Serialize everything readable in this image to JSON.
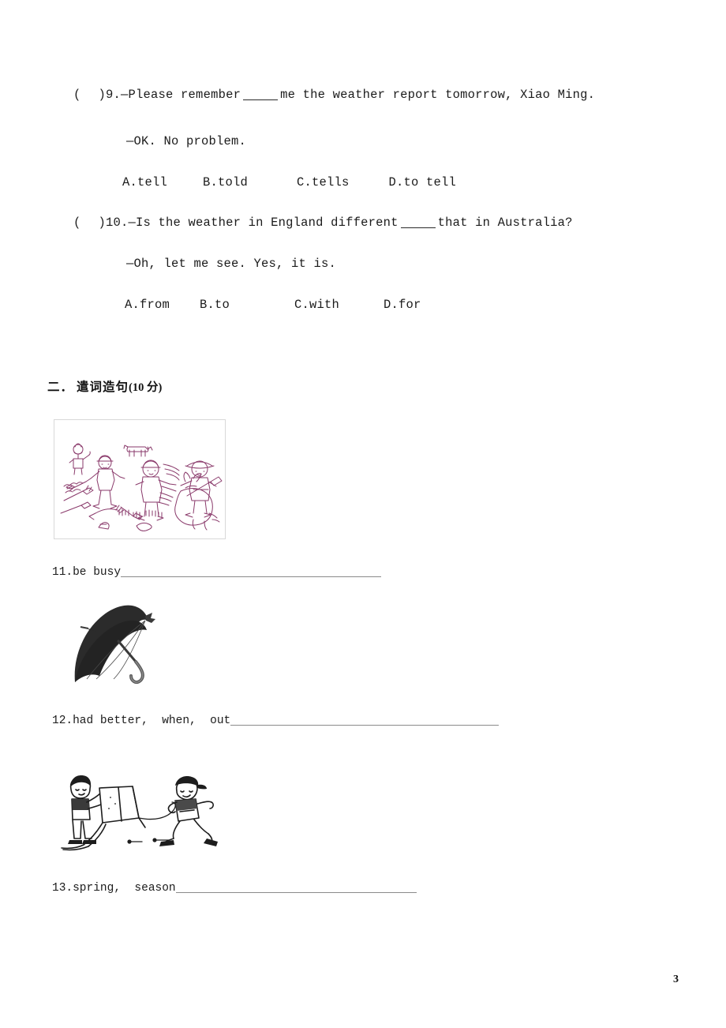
{
  "document": {
    "page_number": "3",
    "questions": [
      {
        "id": "q9",
        "marker_open": "(",
        "marker_close": ")",
        "number": "9.",
        "stem_before": "—Please remember",
        "stem_after": "me the weather report tomorrow, Xiao Ming.",
        "reply": "—OK. No problem.",
        "options": [
          "A.tell",
          "B.told",
          "C.tells",
          "D.to tell"
        ]
      },
      {
        "id": "q10",
        "marker_open": "(",
        "marker_close": ")",
        "number": "10.",
        "stem_before": "—Is the weather in England different",
        "stem_after": "that in Australia?",
        "reply": "—Oh, let me see. Yes, it is.",
        "options": [
          "A.from",
          "B.to",
          "C.with",
          "D.for"
        ]
      }
    ],
    "section": {
      "number": "二．",
      "title": "遣词造句",
      "score": "(10 分)"
    },
    "picture_items": [
      {
        "id": "item11",
        "picture_name": "farm-work-sketch",
        "picture_alt": "line drawing of children and adults busy working on a farm with rakes, hoes, shovels, a dog, a cat and an ox",
        "number": "11.",
        "words": "be busy",
        "answer_rule_width": 330
      },
      {
        "id": "item12",
        "picture_name": "umbrella-photo",
        "picture_alt": "black open umbrella",
        "number": "12.",
        "words": "had better,  when,  out",
        "answer_rule_width": 340
      },
      {
        "id": "item13",
        "picture_name": "kite-flying-sketch",
        "picture_alt": "line drawing of two boys flying a kite in the field",
        "number": "13.",
        "words": "spring,  season",
        "answer_rule_width": 305
      }
    ],
    "colors": {
      "ink": "#1b1b1b",
      "sketch_purple": "#8a3a6b",
      "rule_gray": "#8a8a8a",
      "frame_gray": "#d8d8d8"
    }
  }
}
